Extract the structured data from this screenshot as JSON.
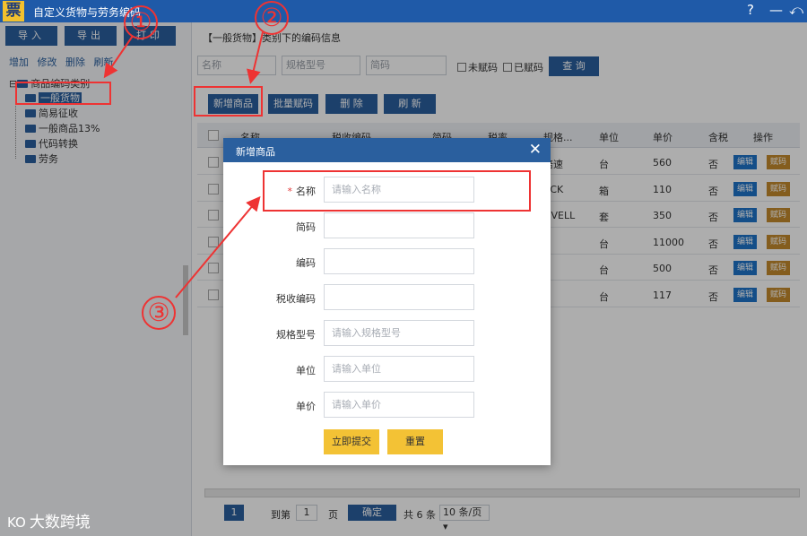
{
  "window": {
    "logo_char": "票",
    "title": "自定义货物与劳务编码",
    "help": "?",
    "minimize": "—",
    "back": "⤺"
  },
  "left": {
    "buttons": [
      "导入",
      "导出",
      "打印"
    ],
    "links": [
      "增加",
      "修改",
      "删除",
      "刷新"
    ],
    "tree": {
      "root": "商品编码类别",
      "items": [
        "一般货物",
        "简易征收",
        "一般商品13%",
        "代码转换",
        "劳务"
      ]
    }
  },
  "main": {
    "breadcrumb": "【一般货物】类别下的编码信息",
    "search": {
      "name_placeholder": "名称",
      "spec_placeholder": "规格型号",
      "short_placeholder": "简码",
      "unassigned": "未赋码",
      "assigned": "已赋码",
      "query": "查 询"
    },
    "toolbar": {
      "new": "新增商品",
      "batch": "批量赋码",
      "delete": "删 除",
      "refresh": "刷 新"
    },
    "table": {
      "headers": [
        "名称",
        "税收编码",
        "简码",
        "税率",
        "规格...",
        "单位",
        "单价",
        "含税",
        "操作"
      ],
      "rows": [
        {
          "spec": "倍速",
          "unit": "台",
          "price": "560",
          "tax": "否"
        },
        {
          "spec": "ACK",
          "unit": "箱",
          "price": "110",
          "tax": "否"
        },
        {
          "spec": "OVELL",
          "unit": "套",
          "price": "350",
          "tax": "否"
        },
        {
          "spec": "",
          "unit": "台",
          "price": "11000",
          "tax": "否"
        },
        {
          "spec": "",
          "unit": "台",
          "price": "500",
          "tax": "否"
        },
        {
          "spec": "",
          "unit": "台",
          "price": "117",
          "tax": "否"
        }
      ],
      "edit": "编辑",
      "code": "赋码"
    },
    "pager": {
      "page": "1",
      "goto": "到第",
      "page_input": "1",
      "page_unit": "页",
      "confirm": "确定",
      "total": "共 6 条",
      "per_page": "10 条/页"
    }
  },
  "modal": {
    "title": "新增商品",
    "fields": [
      {
        "label": "名称",
        "placeholder": "请输入名称",
        "required": true
      },
      {
        "label": "简码",
        "placeholder": "",
        "required": false
      },
      {
        "label": "编码",
        "placeholder": "",
        "required": false
      },
      {
        "label": "税收编码",
        "placeholder": "",
        "required": false
      },
      {
        "label": "规格型号",
        "placeholder": "请输入规格型号",
        "required": false
      },
      {
        "label": "单位",
        "placeholder": "请输入单位",
        "required": false
      },
      {
        "label": "单价",
        "placeholder": "请输入单价",
        "required": false
      }
    ],
    "submit": "立即提交",
    "reset": "重置",
    "required_mark": "*"
  },
  "annotations": {
    "one": "①",
    "two": "②",
    "three": "③"
  },
  "watermark": {
    "mark": "KO",
    "text": "大数跨境"
  },
  "colors": {
    "primary": "#2a5f9e",
    "title_bar": "#1f5aa8",
    "annotation": "#e33333",
    "button_yellow": "#f3c235",
    "code_button": "#c38a2d"
  }
}
